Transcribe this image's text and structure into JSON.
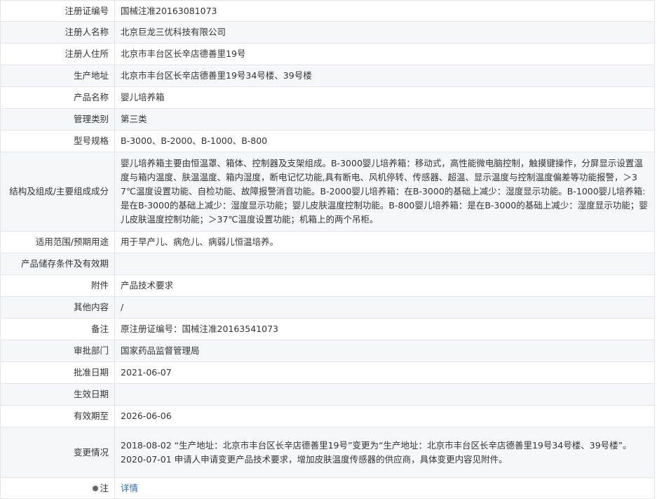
{
  "rows": {
    "reg_no": {
      "label": "注册证编号",
      "value": "国械注准20163081073"
    },
    "registrant_name": {
      "label": "注册人名称",
      "value": "北京巨龙三优科技有限公司"
    },
    "registrant_address": {
      "label": "注册人住所",
      "value": "北京市丰台区长辛店德善里19号"
    },
    "production_address": {
      "label": "生产地址",
      "value": "北京市丰台区长辛店德善里19号34号楼、39号楼"
    },
    "product_name": {
      "label": "产品名称",
      "value": "婴儿培养箱"
    },
    "category": {
      "label": "管理类别",
      "value": "第三类"
    },
    "model": {
      "label": "型号规格",
      "value": "B-3000、B-2000、B-1000、B-800"
    },
    "structure": {
      "label": "结构及组成/主要组成成分",
      "value": "婴儿培养箱主要由恒温罩、箱体、控制器及支架组成。B-3000婴儿培养箱：移动式，高性能微电脑控制，触摸键操作，分屏显示设置温度与箱内温度、肤温温度、箱内湿度，断电记忆功能,具有断电、风机停转、传感器、超温、显示温度与控制温度偏差等功能报警，＞37℃温度设置功能、自检功能、故障报警消音功能。B-2000婴儿培养箱：在B-3000的基础上减少：湿度显示功能。B-1000婴儿培养箱:是在B-3000的基础上减少：湿度显示功能；婴儿皮肤温度控制功能。B-800婴儿培养箱：是在B-3000的基础上减少：湿度显示功能；婴儿皮肤温度控制功能；＞37℃温度设置功能；机箱上的两个吊柜。"
    },
    "intended_use": {
      "label": "适用范围/预期用途",
      "value": "用于早产儿、病危儿、病弱儿恒温培养。"
    },
    "storage": {
      "label": "产品储存条件及有效期",
      "value": ""
    },
    "attachment": {
      "label": "附件",
      "value": "产品技术要求"
    },
    "other": {
      "label": "其他内容",
      "value": "/"
    },
    "remarks": {
      "label": "备注",
      "value": "原注册证编号：国械注准20163541073"
    },
    "approval_dept": {
      "label": "审批部门",
      "value": "国家药品监督管理局"
    },
    "approval_date": {
      "label": "批准日期",
      "value": "2021-06-07"
    },
    "effective_date": {
      "label": "生效日期",
      "value": ""
    },
    "valid_until": {
      "label": "有效期至",
      "value": "2026-06-06"
    },
    "changes": {
      "label": "变更情况",
      "lines": [
        "2018-08-02 “生产地址：北京市丰台区长辛店德善里19号”变更为“生产地址：北京市丰台区长辛店德善里19号34号楼、39号楼”。",
        "2020-07-01 申请人申请变更产品技术要求，增加皮肤温度传感器的供应商，具体变更内容见附件。"
      ]
    },
    "note": {
      "label": "注",
      "icon": "note-bullet-icon",
      "link_text": "详情"
    }
  }
}
